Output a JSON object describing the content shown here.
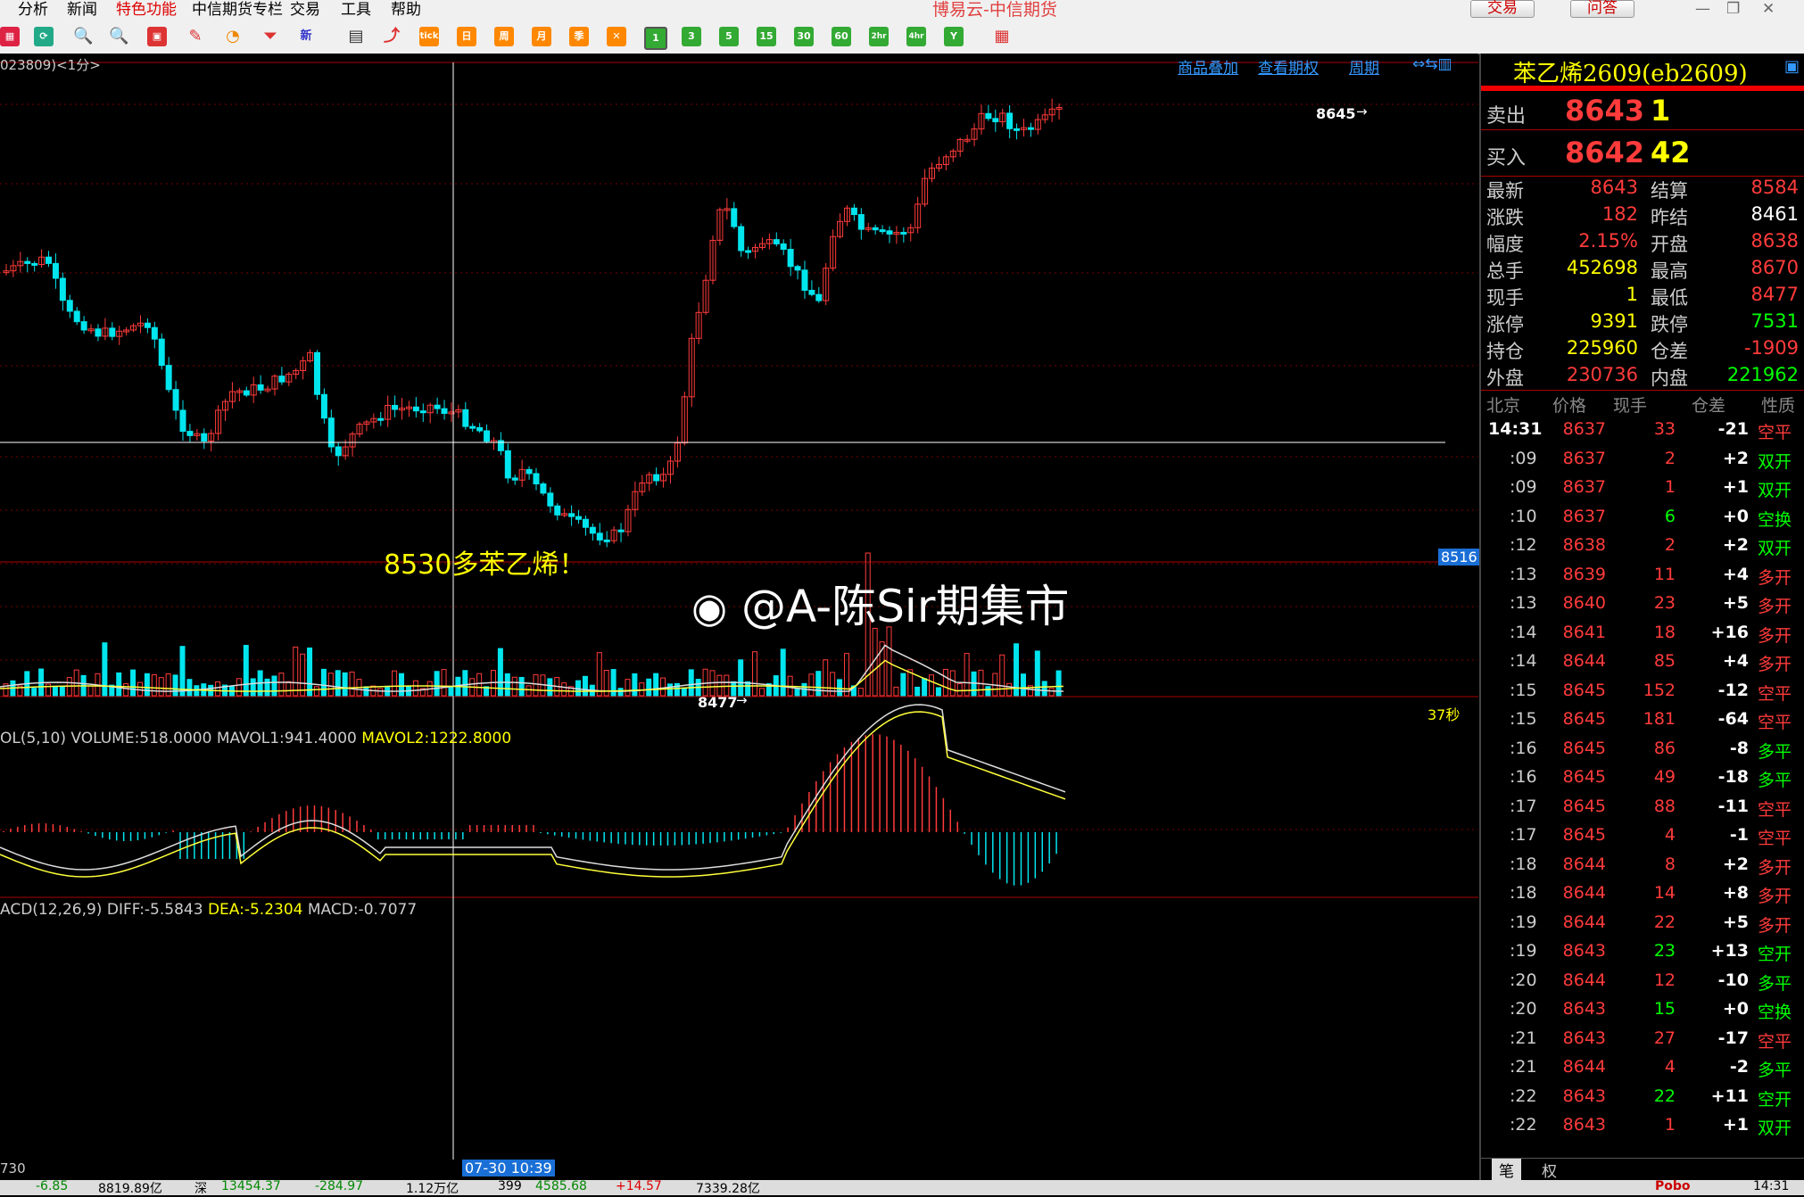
{
  "menu": [
    "分析",
    "新闻",
    "特色功能",
    "中信期货专栏",
    "交易",
    "工具",
    "帮助"
  ],
  "app_title": "博易云-中信期货",
  "top_buttons": {
    "trade": "交易",
    "ask": "问答"
  },
  "toolbar": {
    "periods": [
      "1",
      "3",
      "5",
      "15",
      "30",
      "60",
      "2hr",
      "4hr",
      "Y"
    ],
    "tick": "tick",
    "day": "日",
    "week": "周",
    "month": "月",
    "season": "季"
  },
  "chart_header": {
    "code": "023809)<1分>",
    "overlay": "商品叠加",
    "options": "查看期权",
    "period": "周期"
  },
  "price_panel": {
    "hi_label": "8645",
    "lo_label": "8477",
    "cursor_price": "8516",
    "countdown": "37秒",
    "annotation": "8530多苯乙烯！",
    "watermark": "@A-陈Sir期集市"
  },
  "vol_panel": {
    "title": "OL(5,10)",
    "volume": "VOLUME:518.0000",
    "mavol1": "MAVOL1:941.4000",
    "mavol2": "MAVOL2:1222.8000"
  },
  "macd_panel": {
    "title": "ACD(12,26,9)",
    "diff": "DIFF:-5.5843",
    "dea": "DEA:-5.2304",
    "macd": "MACD:-0.7077"
  },
  "time_axis": {
    "left": "730",
    "cursor": "07-30 10:39"
  },
  "quote": {
    "title": "苯乙烯2609(eb2609)",
    "sell_label": "卖出",
    "sell_price": "8643",
    "sell_qty": "1",
    "buy_label": "买入",
    "buy_price": "8642",
    "buy_qty": "42",
    "rows": [
      [
        "最新",
        "8643",
        "结算",
        "8584"
      ],
      [
        "涨跌",
        "182",
        "昨结",
        "8461"
      ],
      [
        "幅度",
        "2.15%",
        "开盘",
        "8638"
      ],
      [
        "总手",
        "452698",
        "最高",
        "8670"
      ],
      [
        "现手",
        "1",
        "最低",
        "8477"
      ],
      [
        "涨停",
        "9391",
        "跌停",
        "7531"
      ],
      [
        "持仓",
        "225960",
        "仓差",
        "-1909"
      ],
      [
        "外盘",
        "230736",
        "内盘",
        "221962"
      ]
    ]
  },
  "trades_header": [
    "北京",
    "价格",
    "现手",
    "仓差",
    "性质"
  ],
  "trades": [
    [
      "14:31",
      "8637",
      "33",
      "-21",
      "空平"
    ],
    [
      ":09",
      "8637",
      "2",
      "+2",
      "双开"
    ],
    [
      ":09",
      "8637",
      "1",
      "+1",
      "双开"
    ],
    [
      ":10",
      "8637",
      "6",
      "+0",
      "空换"
    ],
    [
      ":12",
      "8638",
      "2",
      "+2",
      "双开"
    ],
    [
      ":13",
      "8639",
      "11",
      "+4",
      "多开"
    ],
    [
      ":13",
      "8640",
      "23",
      "+5",
      "多开"
    ],
    [
      ":14",
      "8641",
      "18",
      "+16",
      "多开"
    ],
    [
      ":14",
      "8644",
      "85",
      "+4",
      "多开"
    ],
    [
      ":15",
      "8645",
      "152",
      "-12",
      "空平"
    ],
    [
      ":15",
      "8645",
      "181",
      "-64",
      "空平"
    ],
    [
      ":16",
      "8645",
      "86",
      "-8",
      "多平"
    ],
    [
      ":16",
      "8645",
      "49",
      "-18",
      "多平"
    ],
    [
      ":17",
      "8645",
      "88",
      "-11",
      "空平"
    ],
    [
      ":17",
      "8645",
      "4",
      "-1",
      "空平"
    ],
    [
      ":18",
      "8644",
      "8",
      "+2",
      "多开"
    ],
    [
      ":18",
      "8644",
      "14",
      "+8",
      "多开"
    ],
    [
      ":19",
      "8644",
      "22",
      "+5",
      "多开"
    ],
    [
      ":19",
      "8643",
      "23",
      "+13",
      "空开"
    ],
    [
      ":20",
      "8644",
      "12",
      "-10",
      "多平"
    ],
    [
      ":20",
      "8643",
      "15",
      "+0",
      "空换"
    ],
    [
      ":21",
      "8643",
      "27",
      "-17",
      "空平"
    ],
    [
      ":21",
      "8644",
      "4",
      "-2",
      "多平"
    ],
    [
      ":22",
      "8643",
      "22",
      "+11",
      "空开"
    ],
    [
      ":22",
      "8643",
      "1",
      "+1",
      "双开"
    ]
  ],
  "bottom_tabs": [
    "笔",
    "权"
  ],
  "status": {
    "seg1": "-6.85",
    "seg2": "8819.89亿",
    "seg3": "深",
    "seg4": "13454.37",
    "seg5": "-284.97",
    "seg6": "1.12万亿",
    "seg7": "399",
    "seg8": "4585.68",
    "seg9": "+14.57",
    "seg10": "7339.28亿",
    "seg11": "Pobo",
    "seg12": "14:31"
  },
  "colors": {
    "up": "#ff3b3b",
    "down": "#00e5ee",
    "yellow": "#ffff3b",
    "gridred": "#7a0000",
    "orange": "#ff8000"
  }
}
